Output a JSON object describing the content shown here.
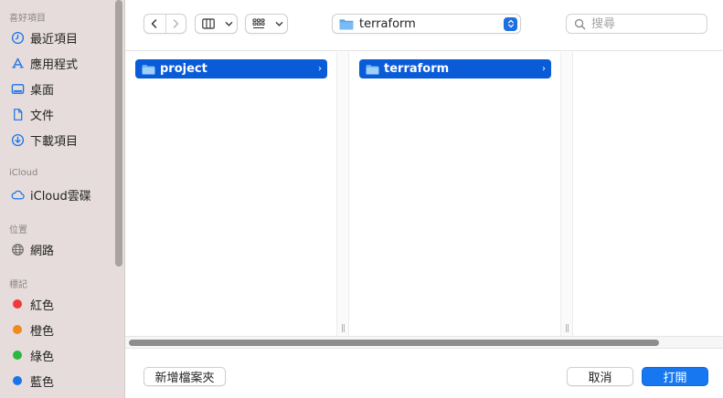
{
  "sidebar": {
    "favorites_title": "喜好項目",
    "favorites": [
      {
        "label": "最近項目",
        "icon": "clock-icon"
      },
      {
        "label": "應用程式",
        "icon": "app-store-icon"
      },
      {
        "label": "桌面",
        "icon": "desktop-icon"
      },
      {
        "label": "文件",
        "icon": "document-icon"
      },
      {
        "label": "下載項目",
        "icon": "download-icon"
      }
    ],
    "icloud_title": "iCloud",
    "icloud": [
      {
        "label": "iCloud雲碟",
        "icon": "cloud-icon"
      }
    ],
    "locations_title": "位置",
    "locations": [
      {
        "label": "網路",
        "icon": "globe-icon"
      }
    ],
    "tags_title": "標記",
    "tags": [
      {
        "label": "紅色",
        "color": "#f0393a"
      },
      {
        "label": "橙色",
        "color": "#f08a1c"
      },
      {
        "label": "綠色",
        "color": "#2bb741"
      },
      {
        "label": "藍色",
        "color": "#1a73e8"
      }
    ]
  },
  "toolbar": {
    "path_label": "terraform",
    "search_placeholder": "搜尋"
  },
  "columns": [
    {
      "selected": "project"
    },
    {
      "selected": "terraform"
    }
  ],
  "footer": {
    "new_folder_label": "新增檔案夾",
    "cancel_label": "取消",
    "open_label": "打開"
  },
  "colors": {
    "accent": "#1677f0",
    "selection": "#0a5bd8",
    "sidebar_bg": "#e6dcdc"
  }
}
